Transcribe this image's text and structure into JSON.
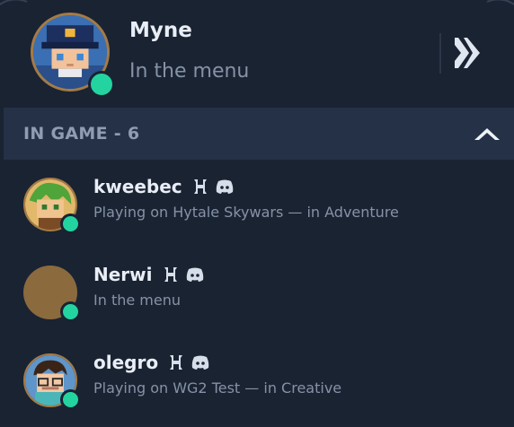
{
  "current_user": {
    "name": "Myne",
    "status_text": "In the menu",
    "online": true
  },
  "section": {
    "title": "IN GAME - 6",
    "toggle_icon": "chevron-up-icon"
  },
  "friends": [
    {
      "name": "kweebec",
      "activity": "Playing on Hytale Skywars — in Adventure",
      "platform_icons": [
        "hytale-icon",
        "discord-icon"
      ],
      "online": true
    },
    {
      "name": "Nerwi",
      "activity": "In the menu",
      "platform_icons": [
        "hytale-icon",
        "discord-icon"
      ],
      "online": true
    },
    {
      "name": "olegro",
      "activity": "Playing on WG2 Test — in Creative",
      "platform_icons": [
        "hytale-icon",
        "discord-icon"
      ],
      "online": true
    }
  ],
  "colors": {
    "background": "#1a2332",
    "section_header": "#253147",
    "online": "#23d4a0",
    "avatar_border": "#a57b45",
    "primary_text": "#e9eef6",
    "secondary_text": "#8592a6"
  }
}
